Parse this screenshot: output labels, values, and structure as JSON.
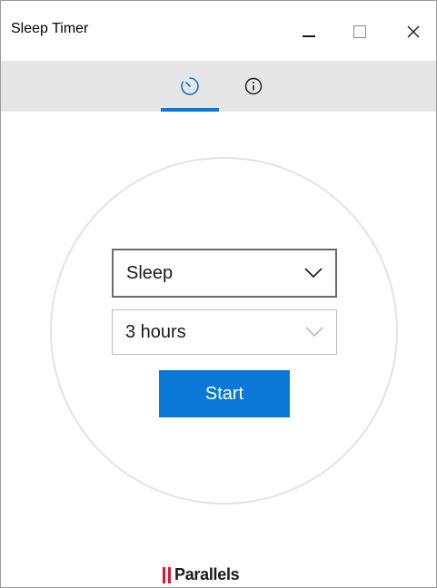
{
  "window": {
    "title": "Sleep Timer",
    "controls": [
      "minimize",
      "maximize",
      "close"
    ]
  },
  "tabs": [
    {
      "id": "timer",
      "icon": "timer-icon",
      "selected": true
    },
    {
      "id": "info",
      "icon": "info-icon",
      "selected": false
    }
  ],
  "form": {
    "action_value": "Sleep",
    "duration_value": "3 hours",
    "start_label": "Start"
  },
  "branding": {
    "logo_text": "Parallels"
  },
  "colors": {
    "accent": "#0a78d7",
    "tab_bar_bg": "#e6e6e6",
    "logo_red": "#e3152d"
  }
}
